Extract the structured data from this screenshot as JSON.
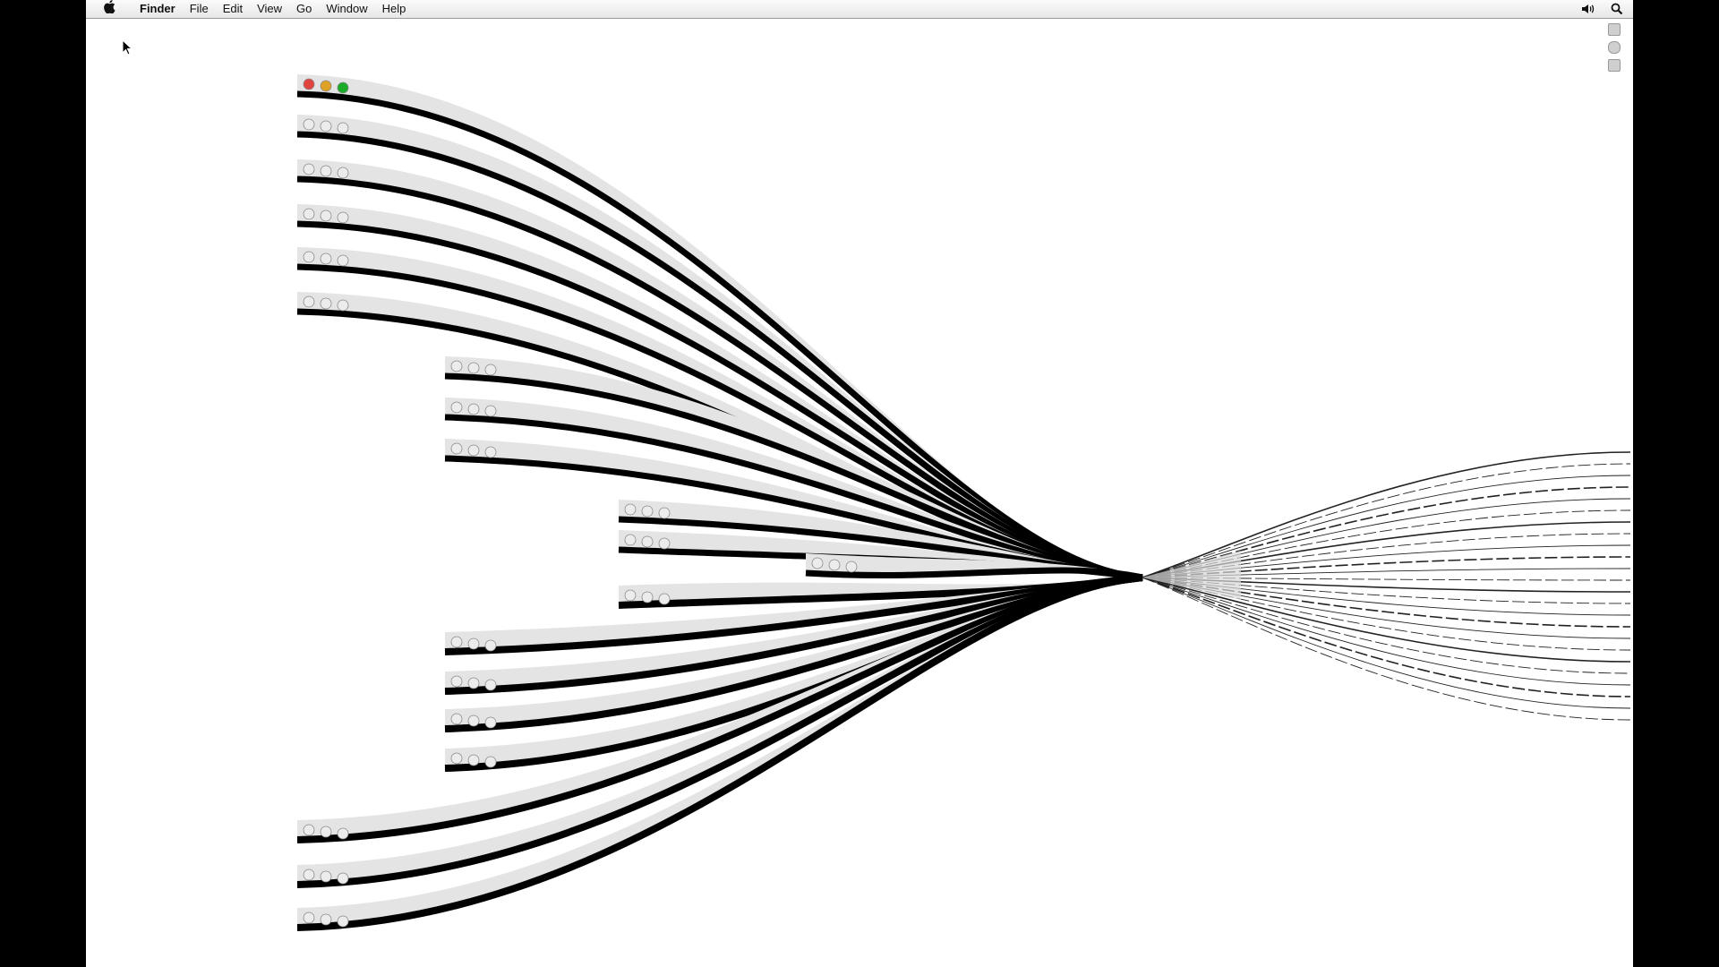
{
  "menubar": {
    "apple_icon": "apple-logo-icon",
    "app_name": "Finder",
    "items": [
      {
        "label": "File"
      },
      {
        "label": "Edit"
      },
      {
        "label": "View"
      },
      {
        "label": "Go"
      },
      {
        "label": "Window"
      },
      {
        "label": "Help"
      }
    ],
    "status_icons": [
      "volume-icon",
      "spotlight-search-icon"
    ]
  },
  "desktop": {
    "background_color": "#ffffff",
    "screen_border_color": "#000000",
    "window_chrome_color": "#e4e4e4",
    "window_edge_color": "#000000",
    "traffic_lights": {
      "close": "#e0443e",
      "minimize": "#dea123",
      "zoom": "#1aab29"
    },
    "animation": "genie-effect",
    "window_count": 22
  }
}
